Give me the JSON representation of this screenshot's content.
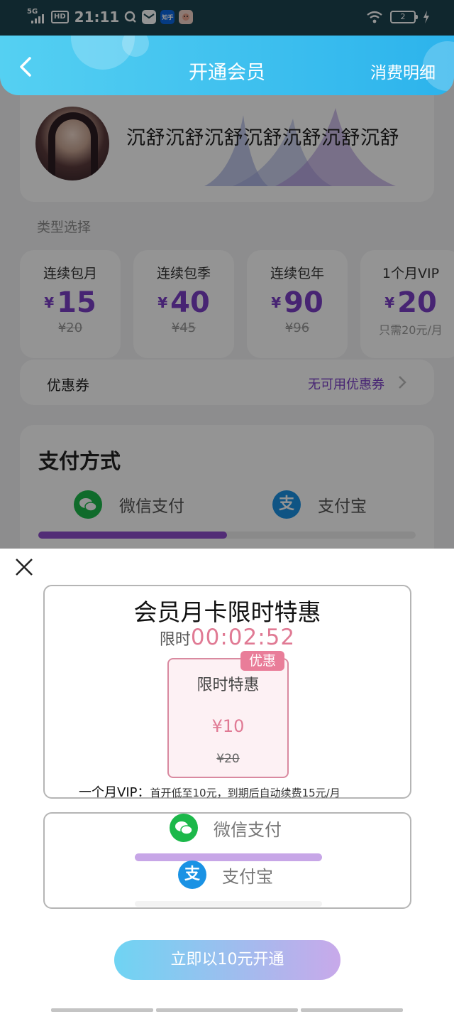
{
  "status_bar": {
    "network": "5G",
    "hd": "HD",
    "time": "21:11",
    "app_icons": [
      "q-icon",
      "mail-icon",
      "zhihu-icon",
      "game-icon"
    ],
    "zhihu_label": "知乎",
    "battery": "2"
  },
  "header": {
    "title": "开通会员",
    "right_link": "消费明细"
  },
  "profile": {
    "username": "沉舒沉舒沉舒沉舒沉舒沉舒沉舒"
  },
  "plans": {
    "section_label": "类型选择",
    "currency": "¥",
    "items": [
      {
        "name": "连续包月",
        "price": "15",
        "original": "¥20"
      },
      {
        "name": "连续包季",
        "price": "40",
        "original": "¥45"
      },
      {
        "name": "连续包年",
        "price": "90",
        "original": "¥96"
      },
      {
        "name": "1个月VIP",
        "price": "20",
        "note": "只需20元/月"
      }
    ]
  },
  "coupon": {
    "label": "优惠券",
    "value": "无可用优惠券"
  },
  "payment": {
    "title": "支付方式",
    "wechat": "微信支付",
    "alipay": "支付宝",
    "alipay_glyph": "支",
    "selected_fraction": 0.5
  },
  "modal": {
    "title": "会员月卡限时特惠",
    "countdown_label": "限时",
    "countdown": "00:02:52",
    "badge": "优惠",
    "deal_name": "限时特惠",
    "deal_price": "¥10",
    "deal_original": "¥20",
    "note_label": "一个月VIP：",
    "note_detail": "首开低至10元，到期后自动续费15元/月",
    "pay_wechat": "微信支付",
    "pay_alipay": "支付宝",
    "pay_alipay_glyph": "支",
    "cta": "立即以10元开通"
  },
  "colors": {
    "header_start": "#55d0f2",
    "header_end": "#2cb3ec",
    "accent_purple": "#7b3fc7",
    "countdown_pink": "#e07a94",
    "wechat_green": "#1cb84a",
    "alipay_blue": "#1a92e4"
  }
}
